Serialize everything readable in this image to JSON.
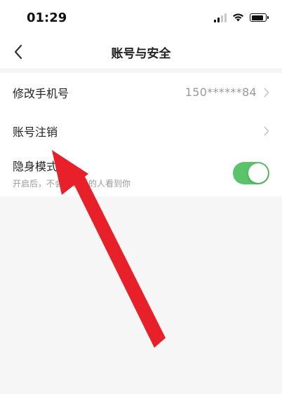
{
  "status_bar": {
    "time": "01:29",
    "icons": [
      "signal-icon",
      "wifi-icon",
      "battery-icon"
    ]
  },
  "nav": {
    "title": "账号与安全",
    "back_icon": "chevron-left-icon"
  },
  "settings": {
    "phone": {
      "label": "修改手机号",
      "value": "150******84"
    },
    "deactivate": {
      "label": "账号注销"
    },
    "stealth": {
      "label": "隐身模式",
      "description": "开启后，不会再有新的人看到你",
      "enabled": true
    }
  },
  "colors": {
    "toggle_on": "#5ac46a",
    "arrow": "#e8202a",
    "background": "#f7f6f6"
  }
}
